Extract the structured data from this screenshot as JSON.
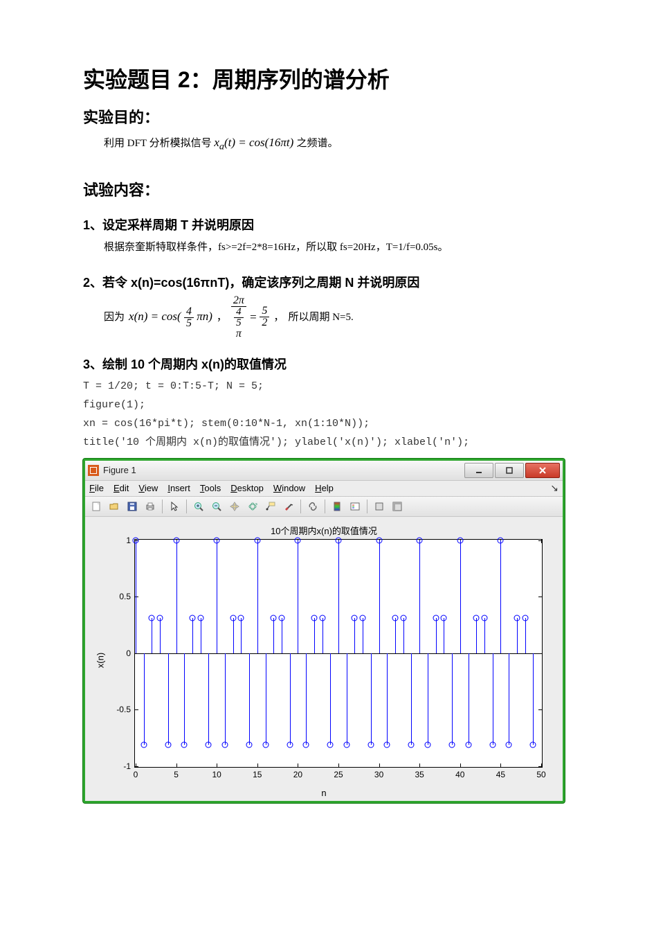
{
  "title": "实验题目 2：周期序列的谱分析",
  "section_purpose": {
    "heading": "实验目的：",
    "prefix": "利用 DFT 分析模拟信号",
    "formula": "xₐ(t) = cos(16πt)",
    "suffix": "之频谱。"
  },
  "section_content": {
    "heading": "试验内容："
  },
  "item1": {
    "heading": "1、设定采样周期 T 并说明原因",
    "body": "根据奈奎斯特取样条件，fs>=2f=2*8=16Hz，所以取 fs=20Hz，T=1/f=0.05s。"
  },
  "item2": {
    "heading": "2、若令 x(n)=cos(16πnT)，确定该序列之周期 N 并说明原因",
    "body_prefix": "因为",
    "eq1_lhs": "x(n) = cos(",
    "eq1_frac_num": "4",
    "eq1_frac_den": "5",
    "eq1_tail": "πn)",
    "sep1": "，",
    "eq2_num": "2π",
    "eq2_den_num": "4",
    "eq2_den_den": "5",
    "eq2_eq": "=",
    "eq2_rhs_num": "5",
    "eq2_rhs_den": "2",
    "sep2": "，",
    "body_suffix": "所以周期 N=5."
  },
  "item3": {
    "heading": "3、绘制 10 个周期内 x(n)的取值情况",
    "code": [
      "T = 1/20; t = 0:T:5-T; N = 5;",
      "figure(1);",
      "xn = cos(16*pi*t); stem(0:10*N-1, xn(1:10*N));",
      "title('10 个周期内 x(n)的取值情况'); ylabel('x(n)'); xlabel('n');"
    ]
  },
  "figure": {
    "window_title": "Figure 1",
    "menu": {
      "file": "File",
      "edit": "Edit",
      "view": "View",
      "insert": "Insert",
      "tools": "Tools",
      "desktop": "Desktop",
      "window": "Window",
      "help": "Help"
    },
    "toolbar": {
      "new": "New Figure",
      "open": "Open",
      "save": "Save",
      "print": "Print",
      "pointer": "Edit Plot",
      "zoomin": "Zoom In",
      "zoomout": "Zoom Out",
      "pan": "Pan",
      "rotate": "Rotate 3D",
      "datacursor": "Data Cursor",
      "brush": "Brush",
      "link": "Link",
      "colorbar": "Insert Colorbar",
      "legend": "Insert Legend",
      "hide": "Hide Plot Tools",
      "show": "Show Plot Tools"
    },
    "plot_title": "10个周期内x(n)的取值情况",
    "ylabel": "x(n)",
    "xlabel": "n",
    "xticks": [
      "0",
      "5",
      "10",
      "15",
      "20",
      "25",
      "30",
      "35",
      "40",
      "45",
      "50"
    ],
    "yticks": [
      "-1",
      "-0.5",
      "0",
      "0.5",
      "1"
    ]
  },
  "chart_data": {
    "type": "stem",
    "title": "10个周期内x(n)的取值情况",
    "xlabel": "n",
    "ylabel": "x(n)",
    "xlim": [
      0,
      50
    ],
    "ylim": [
      -1,
      1
    ],
    "x": [
      0,
      1,
      2,
      3,
      4,
      5,
      6,
      7,
      8,
      9,
      10,
      11,
      12,
      13,
      14,
      15,
      16,
      17,
      18,
      19,
      20,
      21,
      22,
      23,
      24,
      25,
      26,
      27,
      28,
      29,
      30,
      31,
      32,
      33,
      34,
      35,
      36,
      37,
      38,
      39,
      40,
      41,
      42,
      43,
      44,
      45,
      46,
      47,
      48,
      49
    ],
    "y": [
      1.0,
      -0.809,
      0.309,
      0.309,
      -0.809,
      1.0,
      -0.809,
      0.309,
      0.309,
      -0.809,
      1.0,
      -0.809,
      0.309,
      0.309,
      -0.809,
      1.0,
      -0.809,
      0.309,
      0.309,
      -0.809,
      1.0,
      -0.809,
      0.309,
      0.309,
      -0.809,
      1.0,
      -0.809,
      0.309,
      0.309,
      -0.809,
      1.0,
      -0.809,
      0.309,
      0.309,
      -0.809,
      1.0,
      -0.809,
      0.309,
      0.309,
      -0.809,
      1.0,
      -0.809,
      0.309,
      0.309,
      -0.809,
      1.0,
      -0.809,
      0.309,
      0.309,
      -0.809
    ],
    "color": "#0000ff"
  }
}
